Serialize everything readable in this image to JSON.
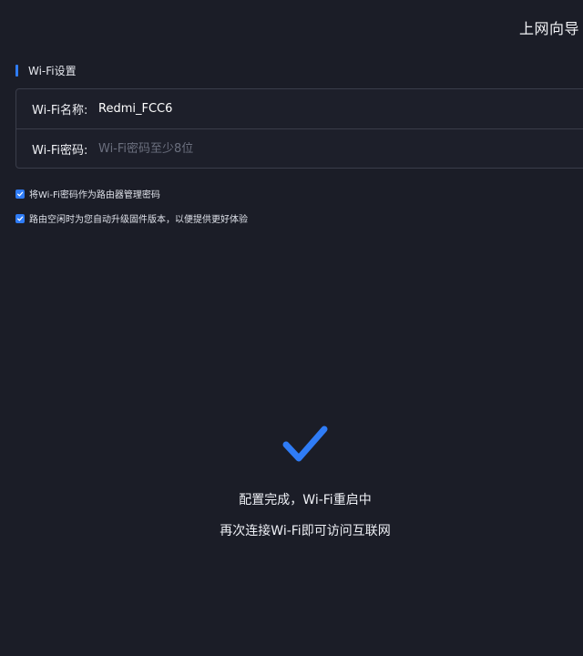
{
  "header": {
    "title": "上网向导"
  },
  "section": {
    "title": "Wi-Fi设置"
  },
  "form": {
    "name_label": "Wi-Fi名称:",
    "name_value": "Redmi_FCC6",
    "password_label": "Wi-Fi密码:",
    "password_placeholder": "Wi-Fi密码至少8位"
  },
  "options": {
    "use_as_admin_password": "将Wi-Fi密码作为路由器管理密码",
    "auto_upgrade": "路由空闲时为您自动升级固件版本，以便提供更好体验"
  },
  "status": {
    "line1": "配置完成，Wi-Fi重启中",
    "line2": "再次连接Wi-Fi即可访问互联网"
  },
  "colors": {
    "accent": "#2f7cf6",
    "background": "#1b1d27"
  },
  "icons": {
    "checkbox": "check-icon",
    "done": "checkmark-icon"
  }
}
